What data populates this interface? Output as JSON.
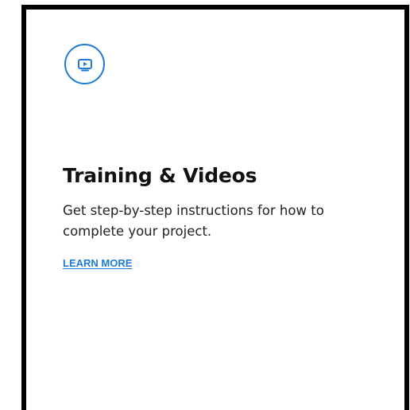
{
  "card": {
    "icon": "video-play-icon",
    "title": "Training & Videos",
    "description": "Get step-by-step instructions for how to complete your project.",
    "link_label": "LEARN MORE"
  },
  "colors": {
    "accent": "#1e7ad4",
    "border": "#000000",
    "text": "#111111",
    "background": "#ffffff"
  }
}
